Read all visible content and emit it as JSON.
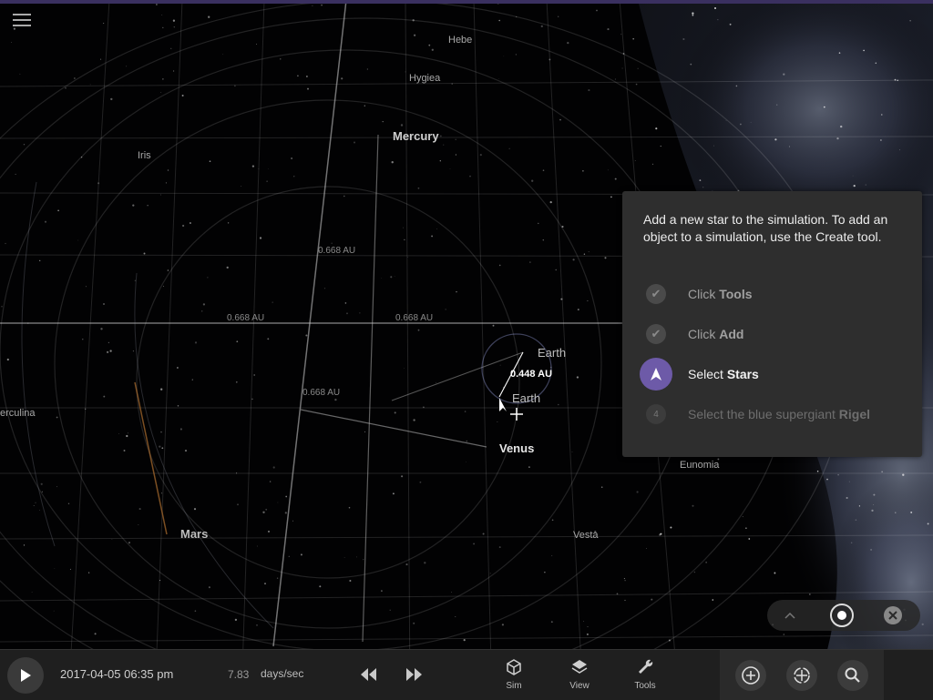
{
  "labels": {
    "hebe": "Hebe",
    "hygiea": "Hygiea",
    "mercury": "Mercury",
    "iris": "Iris",
    "au_top": "0.668 AU",
    "au_left": "0.668 AU",
    "au_mid": "0.668 AU",
    "au_lower": "0.668 AU",
    "earth_top": "Earth",
    "au_measure": "0.448 AU",
    "earth_bottom": "Earth",
    "herculina": "erculina",
    "venus": "Venus",
    "eunomia": "Eunomia",
    "mars": "Mars",
    "vesta": "Vesta"
  },
  "tutorial": {
    "intro": "Add a new star to the simulation. To add an object to a simulation, use the Create tool.",
    "steps": [
      {
        "prefix": "Click ",
        "bold": "Tools",
        "number": ""
      },
      {
        "prefix": "Click ",
        "bold": "Add",
        "number": ""
      },
      {
        "prefix": "Select ",
        "bold": "Stars",
        "number": ""
      },
      {
        "prefix": "Select the blue supergiant ",
        "bold": "Rigel",
        "number": "4"
      }
    ]
  },
  "bottombar": {
    "date": "2017-04-05 06:35 pm",
    "rate_value": "7.83",
    "rate_unit": "days/sec",
    "tools": [
      {
        "label": "Sim"
      },
      {
        "label": "View"
      },
      {
        "label": "Tools"
      }
    ]
  },
  "colors": {
    "accent": "#6d5aa8",
    "panel": "#2e2e2e",
    "bar": "#1f1f1f"
  }
}
